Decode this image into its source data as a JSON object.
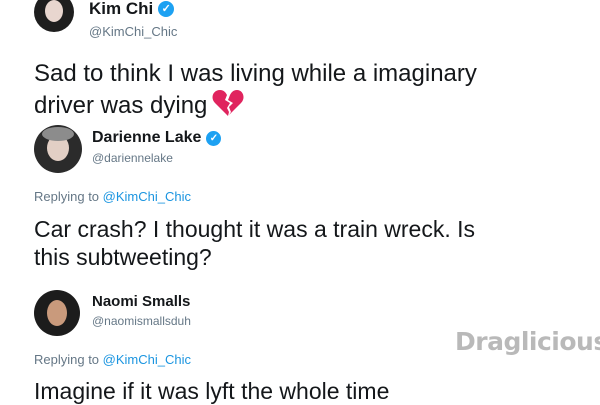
{
  "tweets": [
    {
      "name": "Kim Chi",
      "handle": "@KimChi_Chic",
      "verified": true,
      "reply_prefix": "",
      "reply_to": "",
      "text_line1": "Sad to think I was living while a imaginary",
      "text_line2": "driver was dying",
      "icon": "broken-heart-icon"
    },
    {
      "name": "Darienne Lake",
      "handle": "@darienne­lake",
      "verified": true,
      "reply_prefix": "Replying to",
      "reply_to": "@KimChi_Chic",
      "text_line1": "Car crash? I thought it was a train wreck. Is",
      "text_line2": "this subtweeting?"
    },
    {
      "name": "Naomi Smalls",
      "handle": "@naomismallsduh",
      "verified": false,
      "reply_prefix": "Replying to",
      "reply_to": "@KimChi_Chic",
      "text_line1": "Imagine if it was lyft the whole time"
    }
  ],
  "watermark": "Draglicious",
  "colors": {
    "verified_blue": "#1da1f2",
    "link_blue": "#1b95e0",
    "muted_gray": "#657786",
    "heart_pink": "#e0245e"
  }
}
